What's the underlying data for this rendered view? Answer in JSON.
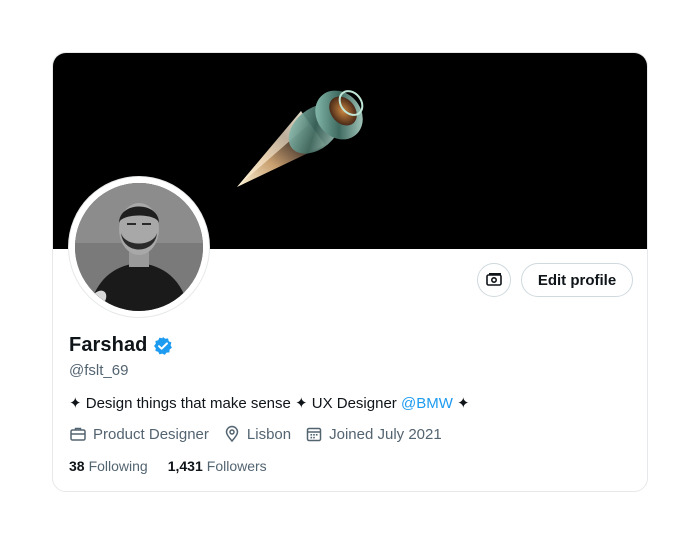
{
  "profile": {
    "name": "Farshad",
    "handle": "@fslt_69",
    "verified": true,
    "verified_color": "#1d9bf0",
    "bio": {
      "prefix": "✦ Design things that make sense ✦ UX Designer ",
      "mention": "@BMW",
      "suffix": " ✦"
    },
    "meta": {
      "work": "Product Designer",
      "location": "Lisbon",
      "joined": "Joined July 2021"
    },
    "stats": {
      "following_count": "38",
      "following_label": "Following",
      "followers_count": "1,431",
      "followers_label": "Followers"
    }
  },
  "actions": {
    "edit_profile_label": "Edit profile",
    "monetization_icon": "money-icon"
  },
  "icons": {
    "work": "briefcase-icon",
    "location": "location-pin-icon",
    "joined": "calendar-icon",
    "verified": "verified-badge-icon"
  },
  "colors": {
    "banner_bg": "#000000",
    "text_primary": "#0f1419",
    "text_secondary": "#536471",
    "accent": "#1d9bf0"
  }
}
